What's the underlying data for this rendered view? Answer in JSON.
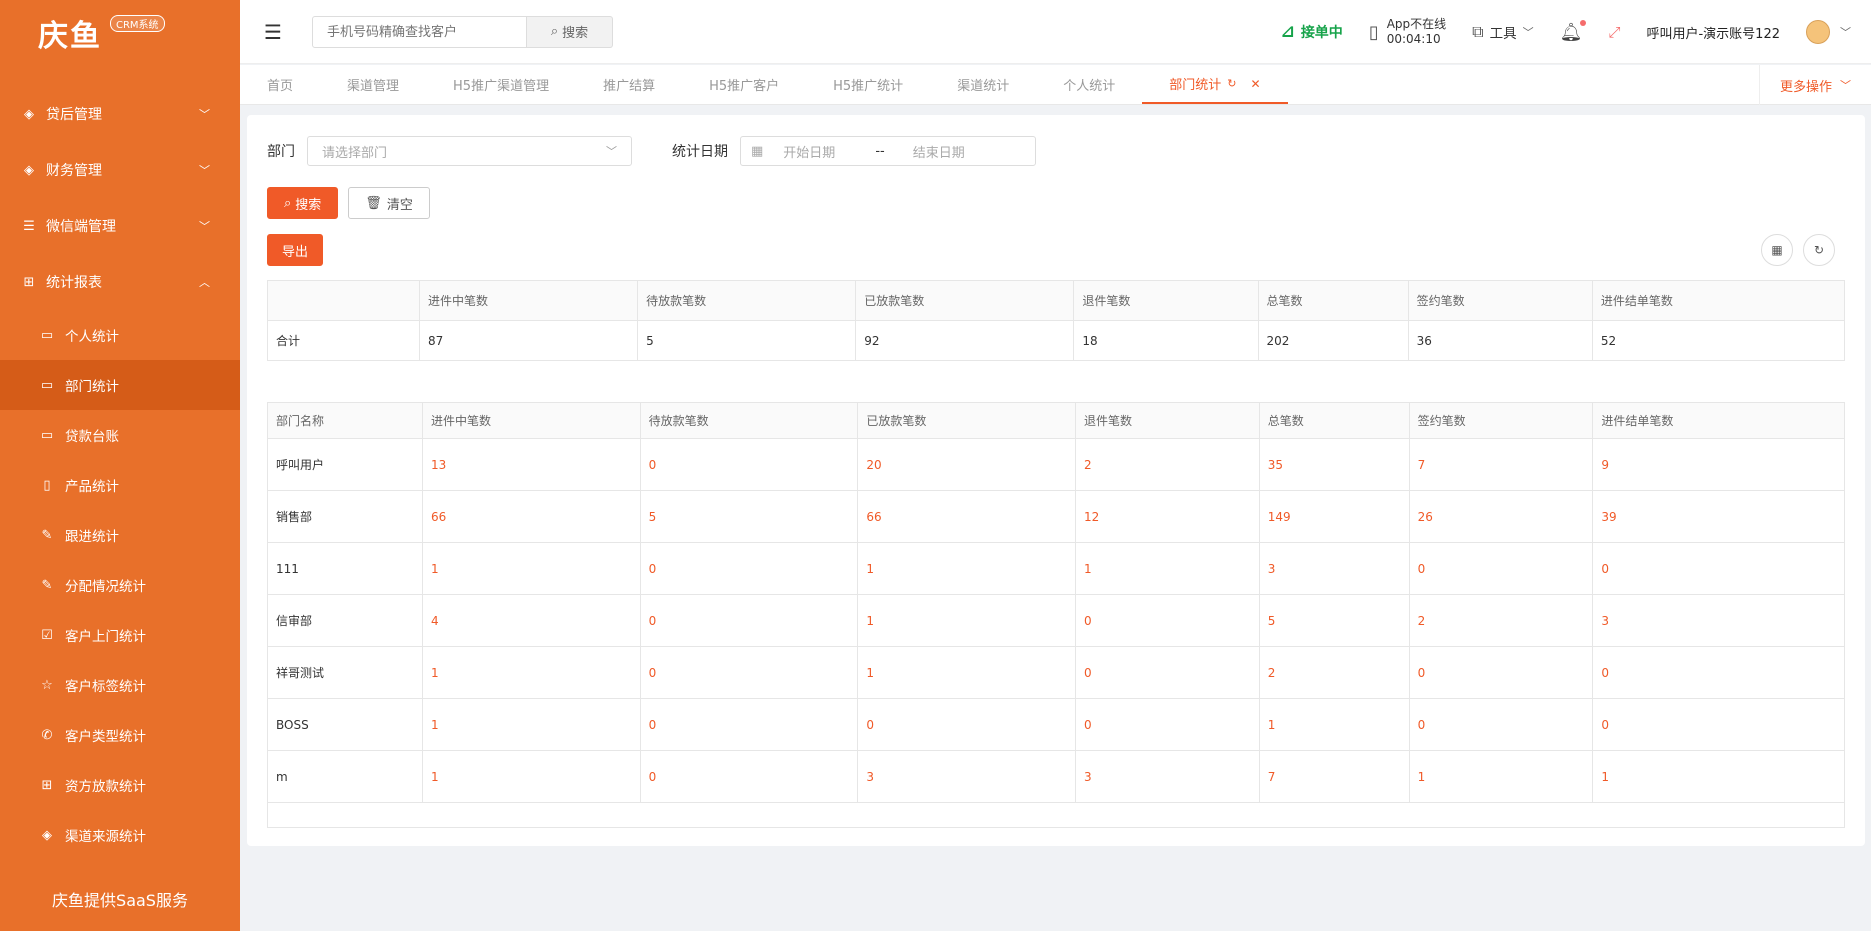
{
  "sidebar": {
    "logo_text": "庆鱼",
    "logo_badge": "CRM系统",
    "groups": [
      {
        "label": "贷后管理",
        "icon": "tag-icon"
      },
      {
        "label": "财务管理",
        "icon": "tag-icon"
      },
      {
        "label": "微信端管理",
        "icon": "edit-icon"
      },
      {
        "label": "统计报表",
        "icon": "table-icon"
      }
    ],
    "items": [
      {
        "label": "个人统计",
        "icon": "monitor-icon"
      },
      {
        "label": "部门统计",
        "icon": "monitor-icon",
        "active": true
      },
      {
        "label": "贷款台账",
        "icon": "monitor-icon"
      },
      {
        "label": "产品统计",
        "icon": "document-icon"
      },
      {
        "label": "跟进统计",
        "icon": "edit-icon"
      },
      {
        "label": "分配情况统计",
        "icon": "edit-icon"
      },
      {
        "label": "客户上门统计",
        "icon": "checkbox-icon"
      },
      {
        "label": "客户标签统计",
        "icon": "star-icon"
      },
      {
        "label": "客户类型统计",
        "icon": "phone-icon"
      },
      {
        "label": "资方放款统计",
        "icon": "grid-icon"
      },
      {
        "label": "渠道来源统计",
        "icon": "tag-icon"
      }
    ],
    "footer": "庆鱼提供SaaS服务"
  },
  "header": {
    "search_placeholder": "手机号码精确查找客户",
    "search_button": "搜索",
    "order_status": "接单中",
    "app_status_line1": "App不在线",
    "app_status_line2": "00:04:10",
    "tools_label": "工具",
    "user_name": "呼叫用户-演示账号122"
  },
  "tabs": {
    "items": [
      "首页",
      "渠道管理",
      "H5推广渠道管理",
      "推广结算",
      "H5推广客户",
      "H5推广统计",
      "渠道统计",
      "个人统计",
      "部门统计"
    ],
    "active_index": 8,
    "more_ops": "更多操作"
  },
  "filters": {
    "dept_label": "部门",
    "dept_placeholder": "请选择部门",
    "date_label": "统计日期",
    "start_placeholder": "开始日期",
    "date_sep": "--",
    "end_placeholder": "结束日期",
    "search_btn": "搜索",
    "clear_btn": "清空",
    "export_btn": "导出"
  },
  "summary_table": {
    "headers": [
      "",
      "进件中笔数",
      "待放款笔数",
      "已放款笔数",
      "退件笔数",
      "总笔数",
      "签约笔数",
      "进件结单笔数"
    ],
    "row": [
      "合计",
      "87",
      "5",
      "92",
      "18",
      "202",
      "36",
      "52"
    ]
  },
  "dept_table": {
    "headers": [
      "部门名称",
      "进件中笔数",
      "待放款笔数",
      "已放款笔数",
      "退件笔数",
      "总笔数",
      "签约笔数",
      "进件结单笔数"
    ],
    "rows": [
      [
        "呼叫用户",
        "13",
        "0",
        "20",
        "2",
        "35",
        "7",
        "9"
      ],
      [
        "销售部",
        "66",
        "5",
        "66",
        "12",
        "149",
        "26",
        "39"
      ],
      [
        "111",
        "1",
        "0",
        "1",
        "1",
        "3",
        "0",
        "0"
      ],
      [
        "信审部",
        "4",
        "0",
        "1",
        "0",
        "5",
        "2",
        "3"
      ],
      [
        "祥哥测试",
        "1",
        "0",
        "1",
        "0",
        "2",
        "0",
        "0"
      ],
      [
        "BOSS",
        "1",
        "0",
        "0",
        "0",
        "1",
        "0",
        "0"
      ],
      [
        "m",
        "1",
        "0",
        "3",
        "3",
        "7",
        "1",
        "1"
      ]
    ]
  },
  "colors": {
    "sidebar": "#e8702a",
    "sidebar_active": "#d55c18",
    "accent": "#f05a28",
    "order_on": "#16a34a"
  }
}
